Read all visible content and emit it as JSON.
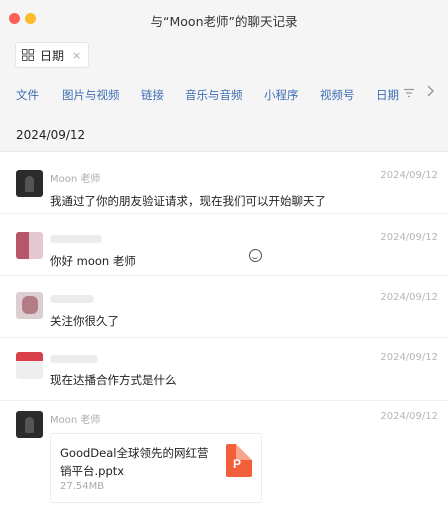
{
  "window": {
    "title": "与“Moon老师”的聊天记录"
  },
  "filter": {
    "chip_label": "日期",
    "chip_close": "×"
  },
  "tabs": [
    {
      "label": "文件"
    },
    {
      "label": "图片与视频"
    },
    {
      "label": "链接"
    },
    {
      "label": "音乐与音频"
    },
    {
      "label": "小程序"
    },
    {
      "label": "视频号"
    },
    {
      "label": "日期"
    }
  ],
  "date_header": "2024/09/12",
  "messages": [
    {
      "sender": "Moon 老师",
      "time": "2024/09/12",
      "text": "我通过了你的朋友验证请求，现在我们可以开始聊天了"
    },
    {
      "sender": "",
      "time": "2024/09/12",
      "text": "你好 moon 老师"
    },
    {
      "sender": "",
      "time": "2024/09/12",
      "text": "关注你很久了"
    },
    {
      "sender": "",
      "time": "2024/09/12",
      "text": "现在达播合作方式是什么"
    },
    {
      "sender": "Moon 老师",
      "time": "2024/09/12",
      "file": {
        "name": "GoodDeal全球领先的网红营销平台.pptx",
        "size": "27.54MB",
        "type_letter": "P"
      }
    }
  ],
  "icons": {
    "grid": "grid-icon",
    "filter": "filter-icon",
    "more": "chevron-right-icon",
    "smiley": "smiley-icon",
    "file": "ppt-file-icon"
  },
  "colors": {
    "tab_text": "#3c6db4",
    "ppt_icon": "#f25f3a"
  }
}
